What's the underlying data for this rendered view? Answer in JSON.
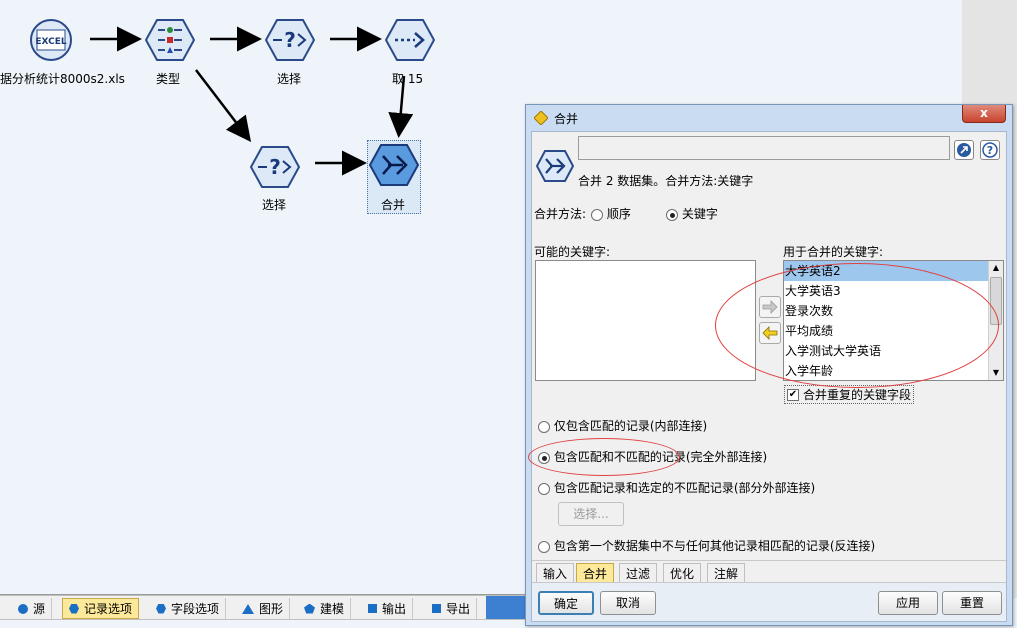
{
  "canvas": {
    "nodes": {
      "excel": {
        "label": "据分析统计8000s2.xls",
        "icon_text": "EXCEL"
      },
      "type": {
        "label": "类型"
      },
      "select1": {
        "label": "选择"
      },
      "sample": {
        "label": "取 15"
      },
      "select2": {
        "label": "选择"
      },
      "merge": {
        "label": "合并"
      }
    }
  },
  "palette": {
    "tabs": [
      {
        "label": "源",
        "icon": "circle-icon"
      },
      {
        "label": "记录选项",
        "icon": "hexagon-icon",
        "active": true
      },
      {
        "label": "字段选项",
        "icon": "hexagon-icon"
      },
      {
        "label": "图形",
        "icon": "triangle-icon"
      },
      {
        "label": "建模",
        "icon": "pentagon-icon"
      },
      {
        "label": "输出",
        "icon": "square-icon"
      },
      {
        "label": "导出",
        "icon": "square-icon"
      }
    ]
  },
  "dialog": {
    "title": "合并",
    "close_label": "x",
    "name_value": "",
    "description": "合并 2 数据集。合并方法:关键字",
    "method_label": "合并方法:",
    "method_options": [
      "顺序",
      "关键字"
    ],
    "possible_keys_label": "可能的关键字:",
    "used_keys_label": "用于合并的关键字:",
    "used_keys": [
      "大学英语2",
      "大学英语3",
      "登录次数",
      "平均成绩",
      "入学测试大学英语",
      "入学年龄"
    ],
    "combine_duplicates_label": "合并重复的关键字段",
    "join_options": [
      "仅包含匹配的记录(内部连接)",
      "包含匹配和不匹配的记录(完全外部连接)",
      "包含匹配记录和选定的不匹配记录(部分外部连接)",
      "包含第一个数据集中不与任何其他记录相匹配的记录(反连接)"
    ],
    "select_button": "选择...",
    "tabs": [
      "输入",
      "合并",
      "过滤",
      "优化",
      "注解"
    ],
    "ok": "确定",
    "cancel": "取消",
    "apply": "应用",
    "reset": "重置"
  },
  "colors": {
    "accent_tab": "#fde99a",
    "node_blue": "#1a3a7a",
    "annotation_red": "#e04040"
  }
}
